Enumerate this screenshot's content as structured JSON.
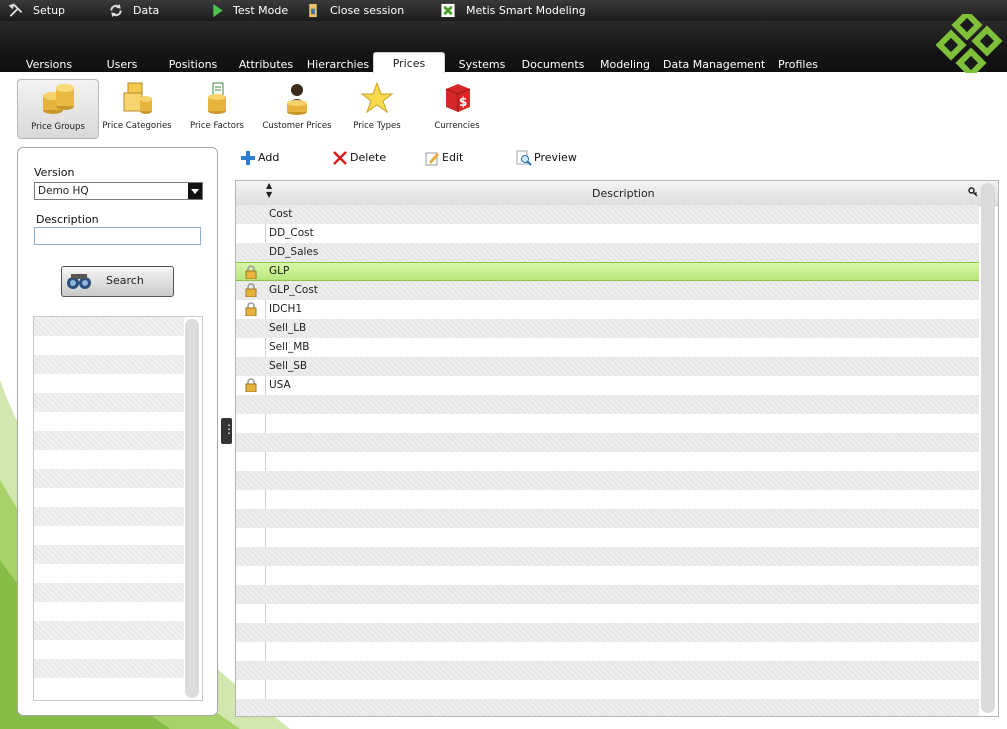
{
  "topbar": {
    "items": [
      {
        "label": "Setup",
        "icon": "tools-icon"
      },
      {
        "label": "Data",
        "icon": "sync-icon"
      },
      {
        "label": "Test Mode",
        "icon": "play-icon"
      },
      {
        "label": "Close session",
        "icon": "close-session-icon"
      },
      {
        "label": "Metis Smart Modeling",
        "icon": "app-logo-icon"
      }
    ]
  },
  "nav": {
    "tabs": [
      "Versions",
      "Users",
      "Positions",
      "Attributes",
      "Hierarchies",
      "Prices",
      "Systems",
      "Documents",
      "Modeling",
      "Data Management",
      "Profiles"
    ],
    "active": "Prices"
  },
  "subnav": {
    "items": [
      {
        "label": "Price Groups",
        "icon": "coins-stack-icon"
      },
      {
        "label": "Price Categories",
        "icon": "coins-folders-icon"
      },
      {
        "label": "Price Factors",
        "icon": "coins-factor-icon"
      },
      {
        "label": "Customer Prices",
        "icon": "customer-coins-icon"
      },
      {
        "label": "Price Types",
        "icon": "star-icon"
      },
      {
        "label": "Currencies",
        "icon": "currency-cube-icon"
      }
    ],
    "active": "Price Groups"
  },
  "filter": {
    "version_label": "Version",
    "version_value": "Demo HQ",
    "description_label": "Description",
    "description_value": "",
    "search_label": "Search"
  },
  "toolbar": {
    "add": "Add",
    "delete": "Delete",
    "edit": "Edit",
    "preview": "Preview"
  },
  "grid": {
    "column": "Description",
    "rows": [
      {
        "description": "Cost",
        "locked": false
      },
      {
        "description": "DD_Cost",
        "locked": false
      },
      {
        "description": "DD_Sales",
        "locked": false
      },
      {
        "description": "GLP",
        "locked": true,
        "selected": true
      },
      {
        "description": "GLP_Cost",
        "locked": true
      },
      {
        "description": "IDCH1",
        "locked": true
      },
      {
        "description": "Sell_LB",
        "locked": false
      },
      {
        "description": "Sell_MB",
        "locked": false
      },
      {
        "description": "Sell_SB",
        "locked": false
      },
      {
        "description": "USA",
        "locked": true
      }
    ]
  },
  "colors": {
    "accent_green": "#8dc63f",
    "topbar": "#1c1c1c",
    "selected_row": "#c5ee8c"
  }
}
